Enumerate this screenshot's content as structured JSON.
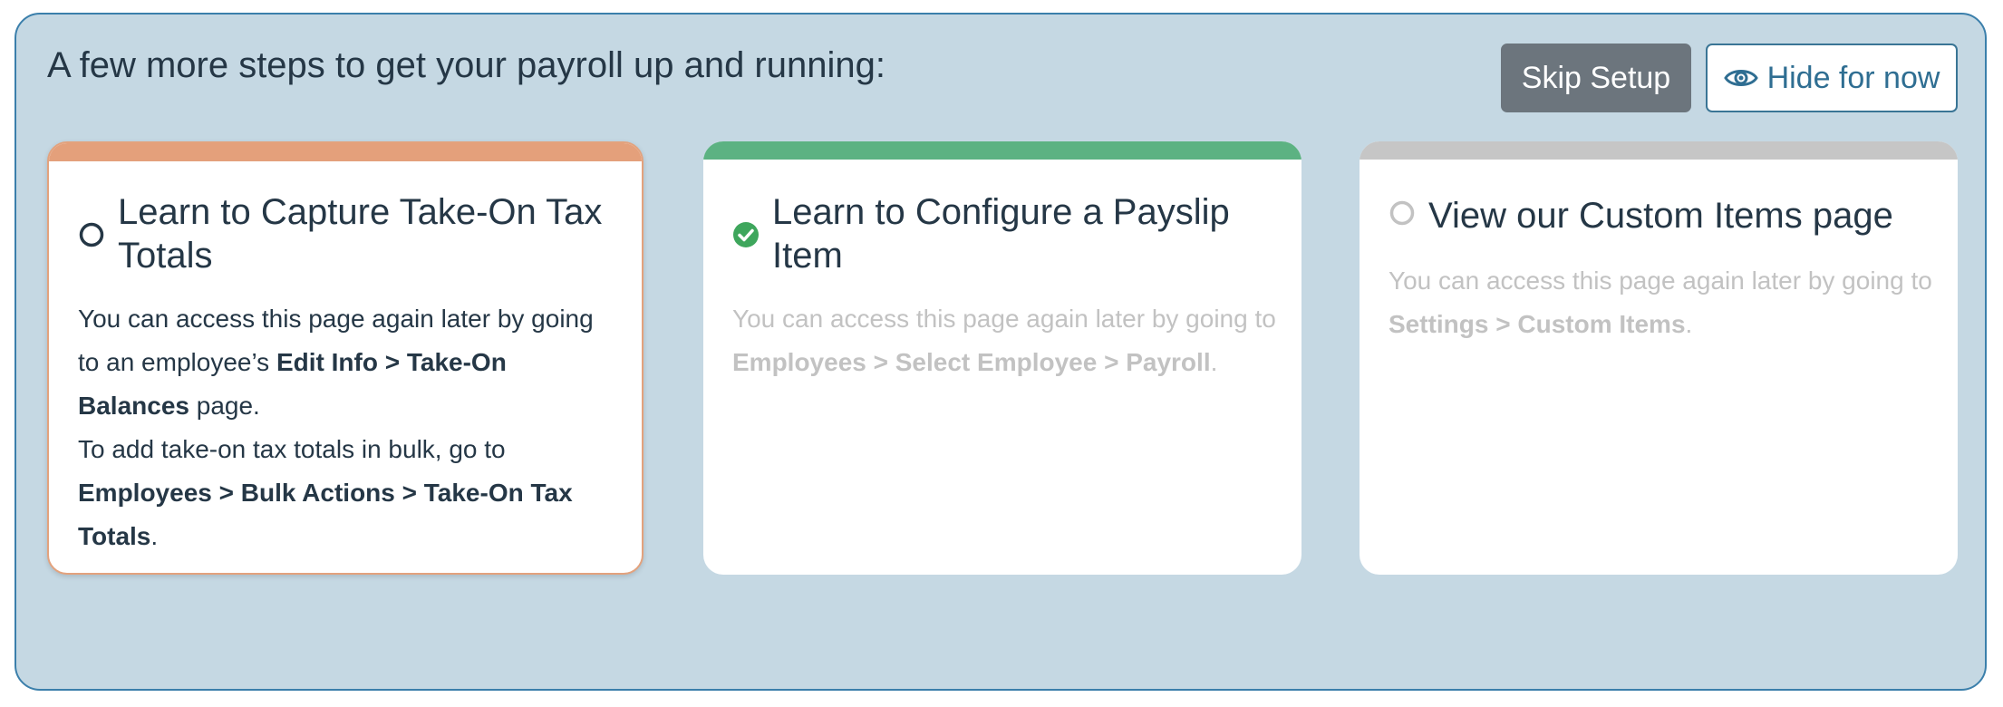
{
  "header": {
    "title": "A few more steps to get your payroll up and running:",
    "skip_label": "Skip Setup",
    "hide_label": "Hide for now"
  },
  "colors": {
    "panel_bg": "#c5d8e3",
    "panel_border": "#3b7fab",
    "active_accent": "#e4a07b",
    "complete_accent": "#5cb282",
    "pending_accent": "#c6c6c6"
  },
  "cards": [
    {
      "status": "active",
      "status_icon": "circle-outline-icon",
      "title": "Learn to Capture Take-On Tax Totals",
      "body": {
        "p1_prefix": "You can access this page again later by going to an employee’s ",
        "p1_path": "Edit Info > Take-On Balances",
        "p1_suffix": " page.",
        "p2_prefix": "To add take-on tax totals in bulk, go to ",
        "p2_path": "Employees > Bulk Actions > Take-On Tax Totals",
        "p2_suffix": "."
      }
    },
    {
      "status": "complete",
      "status_icon": "check-circle-icon",
      "title": "Learn to Configure a Payslip Item",
      "body": {
        "p1_prefix": "You can access this page again later by going to ",
        "p1_path": "Employees > Select Employee > Payroll",
        "p1_suffix": "."
      }
    },
    {
      "status": "pending",
      "status_icon": "circle-outline-icon",
      "title": "View our Custom Items page",
      "body": {
        "p1_prefix": "You can access this page again later by going to ",
        "p1_path": "Settings > Custom Items",
        "p1_suffix": "."
      }
    }
  ]
}
